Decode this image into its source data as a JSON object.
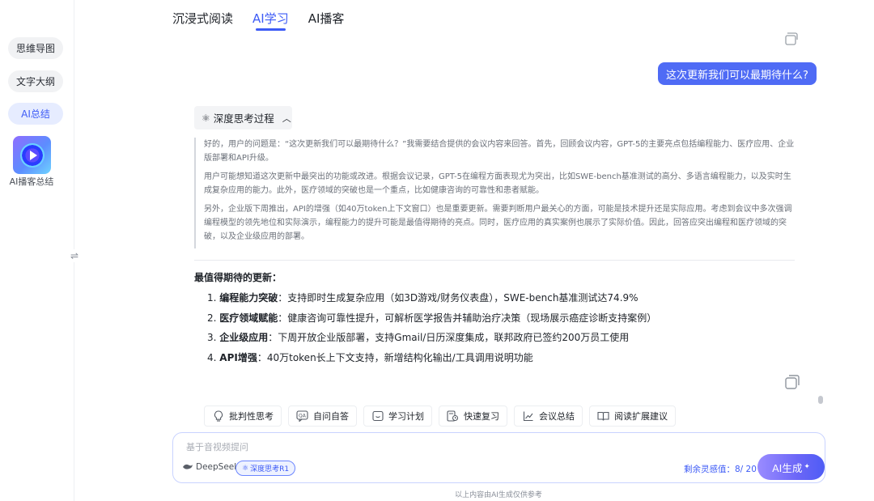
{
  "tabs": [
    "沉浸式阅读",
    "AI学习",
    "AI播客"
  ],
  "active_tab": "AI学习",
  "sidebar": {
    "items": [
      "思维导图",
      "文字大纲",
      "AI总结"
    ],
    "active_item": "AI总结",
    "podcast_label": "AI播客总结"
  },
  "chat": {
    "user_message": "这次更新我们可以最期待什么?",
    "think_toggle_label": "深度思考过程",
    "think_paragraphs": [
      "好的，用户的问题是：“这次更新我们可以最期待什么？”我需要结合提供的会议内容来回答。首先，回顾会议内容，GPT-5的主要亮点包括编程能力、医疗应用、企业版部署和API升级。",
      "用户可能想知道这次更新中最突出的功能或改进。根据会议记录，GPT-5在编程方面表现尤为突出，比如SWE-bench基准测试的高分、多语言编程能力，以及实时生成复杂应用的能力。此外，医疗领域的突破也是一个重点，比如健康咨询的可靠性和患者赋能。",
      "另外，企业版下周推出，API的增强（如40万token上下文窗口）也是重要更新。需要判断用户最关心的方面，可能是技术提升还是实际应用。考虑到会议中多次强调编程模型的领先地位和实际演示，编程能力的提升可能是最值得期待的亮点。同时，医疗应用的真实案例也展示了实际价值。因此，回答应突出编程和医疗领域的突破，以及企业级应用的部署。"
    ],
    "answer_title": "最值得期待的更新：",
    "answer_items": [
      {
        "num": "1.",
        "title": "编程能力突破",
        "text": "：支持即时生成复杂应用（如3D游戏/财务仪表盘），SWE-bench基准测试达74.9%"
      },
      {
        "num": "2.",
        "title": "医疗领域赋能",
        "text": "：健康咨询可靠性提升，可解析医学报告并辅助治疗决策（现场展示癌症诊断支持案例）"
      },
      {
        "num": "3.",
        "title": "企业级应用",
        "text": "：下周开放企业版部署，支持Gmail/日历深度集成，联邦政府已签约200万员工使用"
      },
      {
        "num": "4.",
        "title": "API增强",
        "text": "：40万token长上下文支持，新增结构化输出/工具调用说明功能"
      }
    ]
  },
  "quick_actions": [
    "批判性思考",
    "自问自答",
    "学习计划",
    "快速复习",
    "会议总结",
    "阅读扩展建议"
  ],
  "input": {
    "placeholder": "基于音视频提问",
    "model_name": "DeepSeek",
    "think_chip_label": "深度思考R1",
    "quota_text": "剩余灵感值：8/ 20",
    "generate_label": "AI生成"
  },
  "disclaimer": "以上内容由AI生成仅供参考",
  "colors": {
    "accent": "#3d5bf6",
    "user_bubble": "#4f6bf5"
  }
}
